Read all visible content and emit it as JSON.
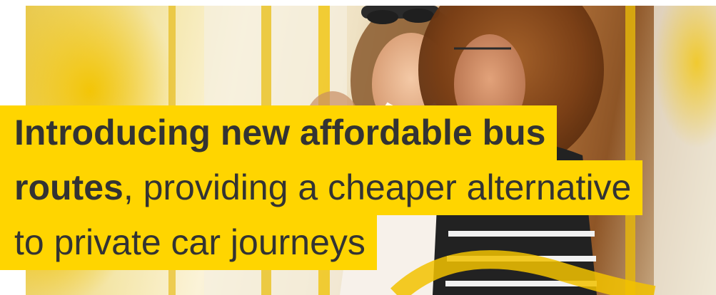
{
  "hero": {
    "headline": {
      "line1_bold": "Introducing new affordable bus",
      "line2_bold": "routes",
      "line2_rest": ", providing a cheaper alternative",
      "line3": "to private car journeys"
    },
    "highlight_color": "#ffd500",
    "text_color": "#333333"
  }
}
